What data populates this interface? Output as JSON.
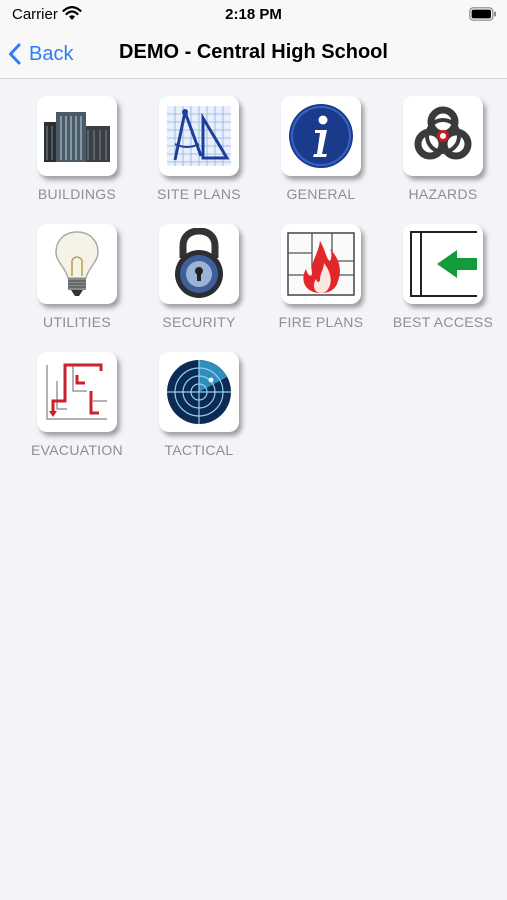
{
  "status_bar": {
    "carrier": "Carrier",
    "time": "2:18 PM"
  },
  "nav": {
    "back_label": "Back",
    "title": "DEMO - Central High School"
  },
  "tiles": [
    {
      "label": "BUILDINGS",
      "icon": "buildings-icon"
    },
    {
      "label": "SITE PLANS",
      "icon": "site-plans-icon"
    },
    {
      "label": "GENERAL",
      "icon": "info-icon"
    },
    {
      "label": "HAZARDS",
      "icon": "biohazard-icon"
    },
    {
      "label": "UTILITIES",
      "icon": "lightbulb-icon"
    },
    {
      "label": "SECURITY",
      "icon": "padlock-icon"
    },
    {
      "label": "FIRE PLANS",
      "icon": "fire-plan-icon"
    },
    {
      "label": "BEST ACCESS",
      "icon": "entry-arrow-icon"
    },
    {
      "label": "EVACUATION",
      "icon": "evacuation-route-icon"
    },
    {
      "label": "TACTICAL",
      "icon": "radar-icon"
    }
  ],
  "colors": {
    "accent": "#2f7cf6",
    "label": "#8e8e93",
    "background": "#f2f4f8"
  }
}
